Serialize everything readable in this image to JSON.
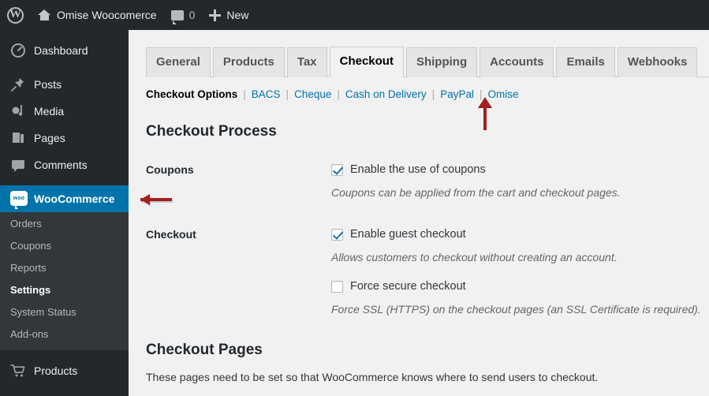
{
  "adminbar": {
    "wp_logo_icon": "wordpress-logo-icon",
    "home_icon": "home-icon",
    "site_name": "Omise Woocomerce",
    "comment_icon": "comment-bubble-icon",
    "comment_count": "0",
    "plus_icon": "plus-icon",
    "new_label": "New"
  },
  "sidebar": {
    "items": [
      {
        "label": "Dashboard",
        "icon": "dashboard-icon",
        "current": false
      },
      {
        "label": "Posts",
        "icon": "pin-icon",
        "current": false
      },
      {
        "label": "Media",
        "icon": "media-icon",
        "current": false
      },
      {
        "label": "Pages",
        "icon": "pages-icon",
        "current": false
      },
      {
        "label": "Comments",
        "icon": "comment-bubble-icon",
        "current": false
      },
      {
        "label": "WooCommerce",
        "icon": "woocommerce-icon",
        "current": true
      },
      {
        "label": "Products",
        "icon": "cart-icon",
        "current": false
      }
    ],
    "woocommerce_submenu": [
      {
        "label": "Orders",
        "current": false
      },
      {
        "label": "Coupons",
        "current": false
      },
      {
        "label": "Reports",
        "current": false
      },
      {
        "label": "Settings",
        "current": true
      },
      {
        "label": "System Status",
        "current": false
      },
      {
        "label": "Add-ons",
        "current": false
      }
    ]
  },
  "tabs": [
    {
      "label": "General",
      "active": false
    },
    {
      "label": "Products",
      "active": false
    },
    {
      "label": "Tax",
      "active": false
    },
    {
      "label": "Checkout",
      "active": true
    },
    {
      "label": "Shipping",
      "active": false
    },
    {
      "label": "Accounts",
      "active": false
    },
    {
      "label": "Emails",
      "active": false
    },
    {
      "label": "Webhooks",
      "active": false
    }
  ],
  "subnav": {
    "items": [
      {
        "label": "Checkout Options",
        "current": true
      },
      {
        "label": "BACS",
        "current": false
      },
      {
        "label": "Cheque",
        "current": false
      },
      {
        "label": "Cash on Delivery",
        "current": false
      },
      {
        "label": "PayPal",
        "current": false
      },
      {
        "label": "Omise",
        "current": false
      }
    ],
    "separator": "|"
  },
  "main": {
    "checkout_process": {
      "heading": "Checkout Process",
      "coupons": {
        "label": "Coupons",
        "checkbox_label": "Enable the use of coupons",
        "checked": true,
        "description": "Coupons can be applied from the cart and checkout pages."
      },
      "checkout": {
        "label": "Checkout",
        "guest": {
          "checkbox_label": "Enable guest checkout",
          "checked": true,
          "description": "Allows customers to checkout without creating an account."
        },
        "secure": {
          "checkbox_label": "Force secure checkout",
          "checked": false,
          "description": "Force SSL (HTTPS) on the checkout pages (an SSL Certificate is required)."
        }
      }
    },
    "checkout_pages": {
      "heading": "Checkout Pages",
      "description": "These pages need to be set so that WooCommerce knows where to send users to checkout."
    }
  },
  "annotations": [
    {
      "name": "arrow-pointing-to-omise",
      "direction": "up",
      "color": "#a51f1f"
    },
    {
      "name": "arrow-pointing-to-woocommerce",
      "direction": "left",
      "color": "#a51f1f"
    }
  ],
  "colors": {
    "adminbar_bg": "#23282d",
    "sidebar_bg": "#23282d",
    "submenu_bg": "#32373c",
    "active_menu_blue": "#0073aa",
    "link_blue": "#0073aa",
    "page_bg": "#f1f1f1",
    "tab_inactive_bg": "#e5e5e5",
    "annotation_red": "#a51f1f"
  }
}
